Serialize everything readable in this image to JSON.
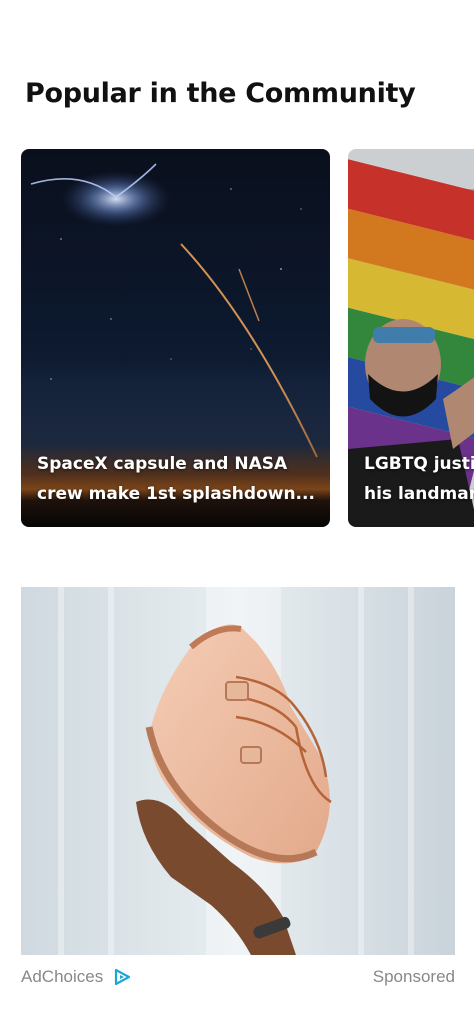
{
  "section": {
    "title": "Popular in the Community"
  },
  "cards": [
    {
      "headline": "SpaceX capsule and NASA\ncrew make 1st splashdown...",
      "image": "rocket-launch-night-sky"
    },
    {
      "headline": "LGBTQ justic\nhis landmar",
      "image": "rainbow-flag-protester"
    }
  ],
  "ad": {
    "image": "sneaker-balanced-on-hand",
    "adchoices_label": "AdChoices",
    "adchoices_icon": "adchoices-icon",
    "sponsored_label": "Sponsored"
  },
  "colors": {
    "text_dark": "#111111",
    "muted": "#888888",
    "adchoices_accent": "#1aa7d8"
  }
}
